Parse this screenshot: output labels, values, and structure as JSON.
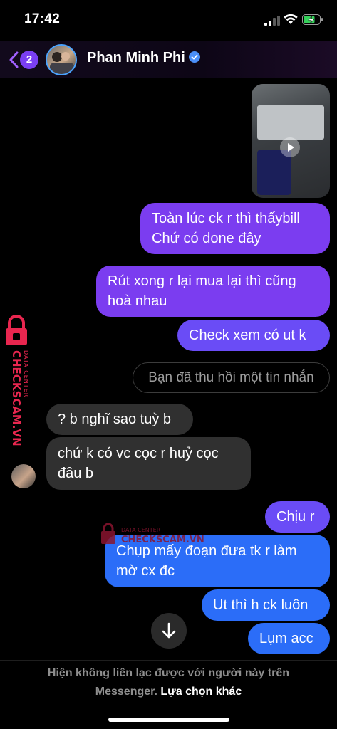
{
  "status_bar": {
    "time": "17:42"
  },
  "header": {
    "back_badge_count": "2",
    "contact_name": "Phan Minh Phi"
  },
  "messages": {
    "out_1": [
      "Toàn lúc ck r thì thấybill",
      "Chứ có done đây"
    ],
    "out_2": [
      "Rút xong r lại mua lại thì cũng",
      "hoà nhau"
    ],
    "out_3": "Check xem có ut k",
    "recall_notice": "Bạn đã thu hồi một tin nhắn",
    "in_1": "? b nghĩ sao tuỳ b",
    "in_2": [
      "chứ k có vc cọc r huỷ cọc",
      "đâu b"
    ],
    "out_4": "Chịu r",
    "out_5": [
      "Chụp mấy đoạn đưa tk r làm",
      "mờ cx đc"
    ],
    "out_6": "Ut thì h ck luôn",
    "out_7": "Lụm acc"
  },
  "watermark": {
    "brand": "CHECKSCAM.VN",
    "tag": "DATA CENTER"
  },
  "footer": {
    "notice_line1": "Hiện không liên lạc được với người này trên",
    "notice_line2": "Messenger.",
    "link": "Lựa chọn khác"
  },
  "colors": {
    "bubble_purple": "#7b3df0",
    "bubble_violet": "#6a4cf6",
    "bubble_blue": "#2b6df8",
    "bubble_incoming": "#303030",
    "badge": "#7a3ff2",
    "watermark": "#e8264f"
  },
  "icons": {
    "back": "chevron-left-icon",
    "verified": "verified-badge-icon",
    "scroll": "arrow-down-icon",
    "signal": "cellular-signal-icon",
    "wifi": "wifi-icon",
    "battery": "battery-charging-icon"
  }
}
